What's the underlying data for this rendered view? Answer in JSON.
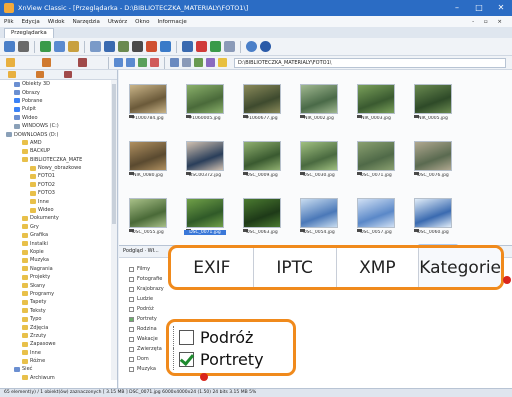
{
  "window": {
    "title": "XnView Classic - [Przeglądarka - D:\\BIBLIOTECZKA_MATERIALY\\FOTO1\\]",
    "minimize": "–",
    "maximize": "□",
    "close": "✕"
  },
  "menu": [
    "Plik",
    "Edycja",
    "Widok",
    "Narzędzia",
    "Utwórz",
    "Okno",
    "Informacje"
  ],
  "menu_right": "- ▫ ×",
  "tab": "Przeglądarka",
  "path": "D:\\BIBLIOTECZKA_MATERIALY\\FOTO1\\",
  "tree": [
    {
      "label": "Obiekty 3D",
      "color": "#6b8fd1"
    },
    {
      "label": "Obrazy",
      "color": "#6b8fd1"
    },
    {
      "label": "Pobrane",
      "color": "#3b82f6"
    },
    {
      "label": "Pulpit",
      "color": "#3b82f6"
    },
    {
      "label": "Wideo",
      "color": "#6b8fd1"
    },
    {
      "label": "WINDOWS (C:)",
      "color": "#8aa0b8"
    },
    {
      "label": "DOWNLOADS (D:)",
      "color": "#8aa0b8"
    },
    {
      "label": "AMD",
      "color": "#e8c04a"
    },
    {
      "label": "BACKUP",
      "color": "#e8c04a"
    },
    {
      "label": "BIBLIOTECZKA_MATE",
      "color": "#e8c04a"
    },
    {
      "label": "Nowy_obrazkowe",
      "color": "#e8c04a"
    },
    {
      "label": "FOTO1",
      "color": "#e8c04a"
    },
    {
      "label": "FOTO2",
      "color": "#e8c04a"
    },
    {
      "label": "FOTO3",
      "color": "#e8c04a"
    },
    {
      "label": "Inne",
      "color": "#e8c04a"
    },
    {
      "label": "Wideo",
      "color": "#e8c04a"
    },
    {
      "label": "Dokumenty",
      "color": "#e8c04a"
    },
    {
      "label": "Gry",
      "color": "#e8c04a"
    },
    {
      "label": "Grafika",
      "color": "#e8c04a"
    },
    {
      "label": "Instalki",
      "color": "#e8c04a"
    },
    {
      "label": "Kopie",
      "color": "#e8c04a"
    },
    {
      "label": "Muzyka",
      "color": "#e8c04a"
    },
    {
      "label": "Nagrania",
      "color": "#e8c04a"
    },
    {
      "label": "Projekty",
      "color": "#e8c04a"
    },
    {
      "label": "Skany",
      "color": "#e8c04a"
    },
    {
      "label": "Programy",
      "color": "#e8c04a"
    },
    {
      "label": "Tapety",
      "color": "#e8c04a"
    },
    {
      "label": "Teksty",
      "color": "#e8c04a"
    },
    {
      "label": "Typo",
      "color": "#e8c04a"
    },
    {
      "label": "Zdjęcia",
      "color": "#e8c04a"
    },
    {
      "label": "Zrzuty",
      "color": "#e8c04a"
    },
    {
      "label": "Zapasowe",
      "color": "#e8c04a"
    },
    {
      "label": "Inne",
      "color": "#e8c04a"
    },
    {
      "label": "Różne",
      "color": "#e8c04a"
    },
    {
      "label": "Sieć",
      "color": "#6b8fd1"
    },
    {
      "label": "Archiwum",
      "color": "#e8c04a"
    }
  ],
  "thumbnails": [
    {
      "name": "P1000784.jpg",
      "c1": "#6b5a3a",
      "c2": "#c9b488"
    },
    {
      "name": "P1060005.jpg",
      "c1": "#4a6a3a",
      "c2": "#8ab06a"
    },
    {
      "name": "P1060677.jpg",
      "c1": "#3e4a2e",
      "c2": "#8a8a5a"
    },
    {
      "name": "NIK_0002.jpg",
      "c1": "#4a6a48",
      "c2": "#a0b890"
    },
    {
      "name": "NIK_0003.jpg",
      "c1": "#3a5a30",
      "c2": "#7aa05a"
    },
    {
      "name": "NIK_0005.jpg",
      "c1": "#2e4a28",
      "c2": "#6a8a50"
    },
    {
      "name": "NIK_0080.jpg",
      "c1": "#5a4a30",
      "c2": "#b09060"
    },
    {
      "name": "DSC00372.jpg",
      "c1": "#2a3e5a",
      "c2": "#d0c0b0"
    },
    {
      "name": "DSC_0009.jpg",
      "c1": "#3a5a30",
      "c2": "#90b070"
    },
    {
      "name": "DSC_0030.jpg",
      "c1": "#4a6a40",
      "c2": "#a0c080"
    },
    {
      "name": "DSC_0071.jpg",
      "c1": "#506a48",
      "c2": "#8aa070"
    },
    {
      "name": "DSC_0076.jpg",
      "c1": "#5a6a50",
      "c2": "#b0a890"
    },
    {
      "name": "DSC_0055.jpg",
      "c1": "#4a6a38",
      "c2": "#a8c088"
    },
    {
      "name": "DSC_0071.jpg",
      "c1": "#305a28",
      "c2": "#70a048"
    },
    {
      "name": "DSC_0063.jpg",
      "c1": "#1e3a18",
      "c2": "#4a7a30"
    },
    {
      "name": "DSC_0054.jpg",
      "c1": "#4a78b8",
      "c2": "#c8dcf0"
    },
    {
      "name": "DSC_0057.jpg",
      "c1": "#5a88c8",
      "c2": "#d0e0f4"
    },
    {
      "name": "DSC_0060.jpg",
      "c1": "#3a6ab0",
      "c2": "#e0ecf8"
    }
  ],
  "selected_thumbnail": "DSC_0071.jpg",
  "bottom_panel": {
    "header": "Podgląd · Wł...",
    "categories": [
      {
        "label": "Filmy",
        "checked": false
      },
      {
        "label": "Fotografie",
        "checked": false
      },
      {
        "label": "Krajobrazy",
        "checked": false
      },
      {
        "label": "Ludzie",
        "checked": false
      },
      {
        "label": "Podróż",
        "checked": false
      },
      {
        "label": "Portrety",
        "checked": true
      },
      {
        "label": "Rodzina",
        "checked": false
      },
      {
        "label": "Wakacje",
        "checked": false
      },
      {
        "label": "Zwierzęta",
        "checked": false
      },
      {
        "label": "Dom",
        "checked": false
      },
      {
        "label": "Muzyka",
        "checked": false
      }
    ]
  },
  "callout_tabs": [
    "EXIF",
    "IPTC",
    "XMP",
    "Kategorie"
  ],
  "callout_categories": [
    {
      "label": "Podróż",
      "checked": false
    },
    {
      "label": "Portrety",
      "checked": true
    }
  ],
  "status": "65 element(y) / 1 obiekt(ów) zaznaczonych  [ 3.15 MB ]  DSC_0071.jpg  6000x4000x24 (1.50)  24 bits  3.15 MB  5%",
  "accent": "#f08a1c",
  "marker": "#d9261c"
}
